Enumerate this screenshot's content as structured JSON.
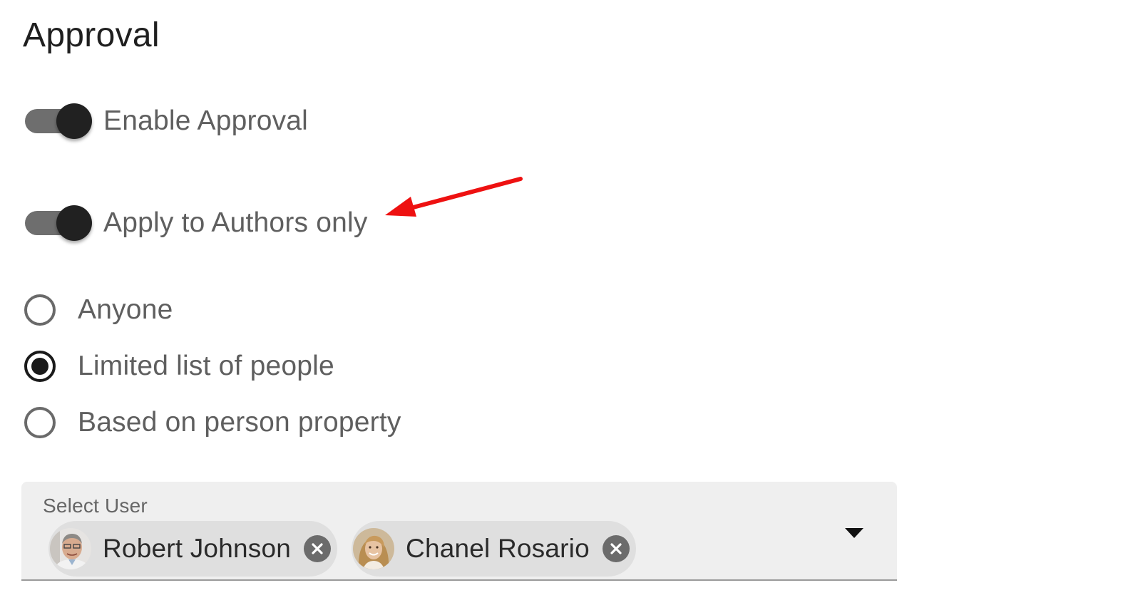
{
  "page": {
    "title": "Approval"
  },
  "toggles": {
    "enable_approval": {
      "label": "Enable Approval",
      "on": true
    },
    "authors_only": {
      "label": "Apply to Authors only",
      "on": true
    }
  },
  "approvers": {
    "options": [
      {
        "label": "Anyone",
        "selected": false
      },
      {
        "label": "Limited list of people",
        "selected": true
      },
      {
        "label": "Based on person property",
        "selected": false
      }
    ]
  },
  "select_user": {
    "label": "Select User",
    "chips": [
      {
        "name": "Robert Johnson",
        "avatar": "man-avatar-icon"
      },
      {
        "name": "Chanel Rosario",
        "avatar": "woman-avatar-icon"
      }
    ],
    "dropdown_icon": "caret-down-icon"
  },
  "annotation": {
    "color": "#ee1111",
    "icon": "red-arrow-annotation"
  },
  "colors": {
    "toggle_track": "#6e6e6e",
    "toggle_thumb": "#212121",
    "field_background": "#efefef",
    "chip_background": "#dfdfdf"
  }
}
